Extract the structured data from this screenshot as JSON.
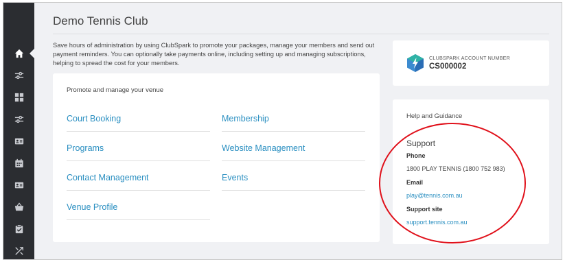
{
  "page": {
    "title": "Demo Tennis Club",
    "intro": "Save hours of administration by using ClubSpark to promote your packages, manage your members and send out payment reminders. You can optionally take payments online, including setting up and managing subscriptions, helping to spread the cost for your members."
  },
  "sidebar": {
    "items": [
      {
        "icon": "home-icon"
      },
      {
        "icon": "sliders-icon"
      },
      {
        "icon": "grid-icon"
      },
      {
        "icon": "sliders-icon"
      },
      {
        "icon": "id-card-icon"
      },
      {
        "icon": "calendar-icon"
      },
      {
        "icon": "contact-card-icon"
      },
      {
        "icon": "basket-icon"
      },
      {
        "icon": "clipboard-check-icon"
      },
      {
        "icon": "shuffle-icon"
      }
    ]
  },
  "promote": {
    "heading": "Promote and manage your venue",
    "left_links": [
      "Court Booking",
      "Programs",
      "Contact Management",
      "Venue Profile"
    ],
    "right_links": [
      "Membership",
      "Website Management",
      "Events"
    ]
  },
  "account": {
    "label": "CLUBSPARK ACCOUNT NUMBER",
    "number": "CS000002"
  },
  "help": {
    "heading": "Help and Guidance",
    "support_title": "Support",
    "phone_label": "Phone",
    "phone_value": "1800 PLAY TENNIS (1800 752 983)",
    "email_label": "Email",
    "email_value": "play@tennis.com.au",
    "site_label": "Support site",
    "site_value": "support.tennis.com.au"
  },
  "colors": {
    "sidebar_bg": "#2b2d31",
    "link": "#2a8fc1",
    "annotation": "#e0101a",
    "logo_teal": "#2fb3a6",
    "logo_blue": "#2a6db5"
  }
}
